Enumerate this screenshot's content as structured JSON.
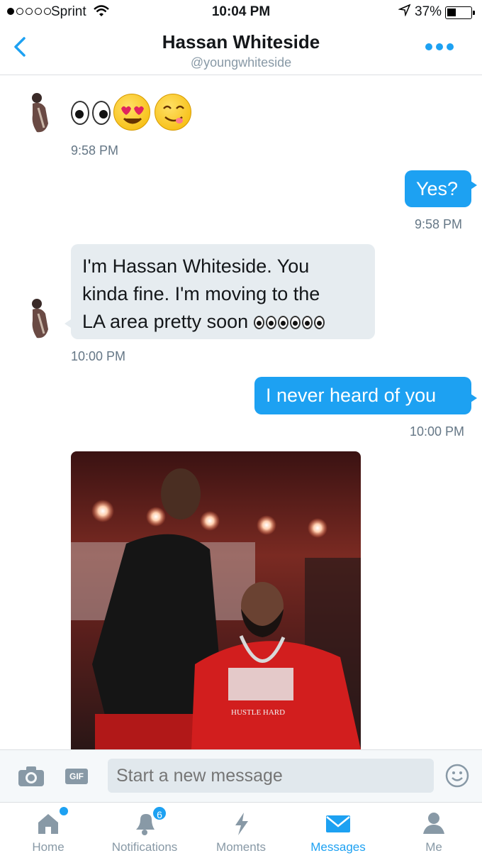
{
  "status_bar": {
    "carrier": "Sprint",
    "time": "10:04 PM",
    "battery_pct": "37%",
    "battery_level": 0.37
  },
  "header": {
    "name": "Hassan Whiteside",
    "handle": "@youngwhiteside"
  },
  "messages": [
    {
      "direction": "in",
      "content": "emoji",
      "emojis": [
        "eyes-icon",
        "heart-eyes-icon",
        "yum-icon"
      ],
      "time": "9:58 PM"
    },
    {
      "direction": "out",
      "text": "Yes?",
      "time": "9:58 PM"
    },
    {
      "direction": "in",
      "lines": [
        "I'm Hassan Whiteside. You",
        "kinda fine. I'm moving to the",
        "LA area pretty soon"
      ],
      "trailing_emojis": [
        "eyes-icon",
        "eyes-icon",
        "eyes-icon"
      ],
      "time": "10:00 PM"
    },
    {
      "direction": "out",
      "text": "I never heard of you",
      "time": "10:00 PM"
    },
    {
      "direction": "in",
      "content": "photo",
      "photo_shirt_text": "HUSTLE HARD"
    }
  ],
  "composer": {
    "gif_label": "GIF",
    "placeholder": "Start a new message"
  },
  "tabs": [
    {
      "label": "Home",
      "icon": "home-icon",
      "has_dot": true
    },
    {
      "label": "Notifications",
      "icon": "bell-icon",
      "badge": "6"
    },
    {
      "label": "Moments",
      "icon": "lightning-icon"
    },
    {
      "label": "Messages",
      "icon": "envelope-icon",
      "active": true
    },
    {
      "label": "Me",
      "icon": "person-icon"
    }
  ],
  "colors": {
    "accent": "#1da1f2",
    "incoming_bubble": "#e6ecf0",
    "muted_text": "#8899a6"
  }
}
